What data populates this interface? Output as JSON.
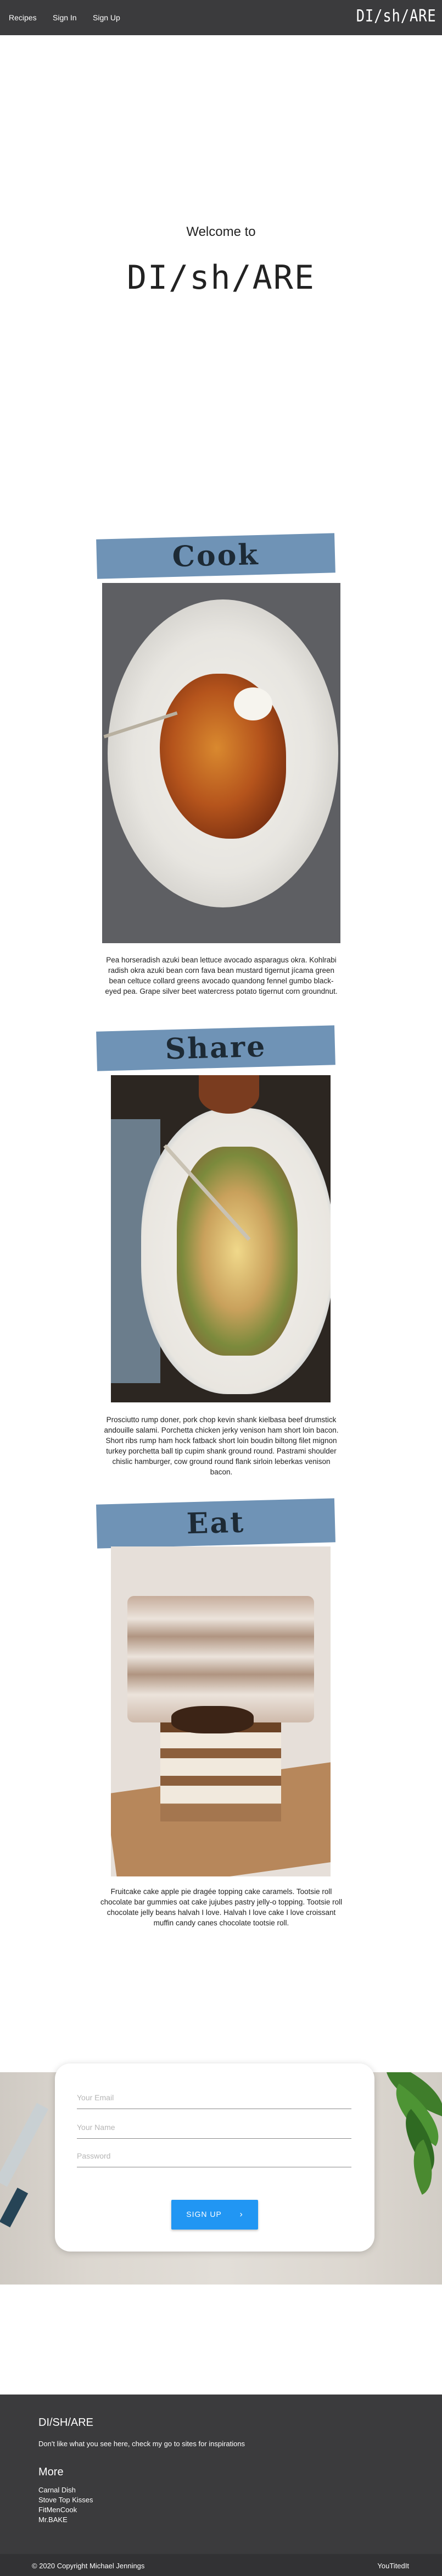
{
  "nav": {
    "links": [
      "Recipes",
      "Sign In",
      "Sign Up"
    ],
    "brand": "DI/sh/ARE"
  },
  "hero": {
    "welcome": "Welcome to",
    "logo": "DI/sh/ARE"
  },
  "sections": [
    {
      "title": "Cook",
      "text": "Pea horseradish azuki bean lettuce avocado asparagus okra. Kohlrabi radish okra azuki bean corn fava bean mustard tigernut jícama green bean celtuce collard greens avocado quandong fennel gumbo black-eyed pea. Grape silver beet watercress potato tigernut corn groundnut."
    },
    {
      "title": "Share",
      "text": "Prosciutto rump doner, pork chop kevin shank kielbasa beef drumstick andouille salami. Porchetta chicken jerky venison ham short loin bacon. Short ribs rump ham hock fatback short loin boudin biltong filet mignon turkey porchetta ball tip cupim shank ground round. Pastrami shoulder chislic hamburger, cow ground round flank sirloin leberkas venison bacon."
    },
    {
      "title": "Eat",
      "text": "Fruitcake cake apple pie dragée topping cake caramels. Tootsie roll chocolate bar gummies oat cake jujubes pastry jelly-o topping. Tootsie roll chocolate jelly beans halvah I love. Halvah I love cake I love croissant muffin candy canes chocolate tootsie roll."
    }
  ],
  "signup": {
    "email_placeholder": "Your Email",
    "name_placeholder": "Your Name",
    "password_placeholder": "Password",
    "button_label": "SIGN UP",
    "button_icon": "chevron-right-icon",
    "button_color": "#2196f3"
  },
  "footer": {
    "title": "DI/SH/ARE",
    "text": "Don't like what you see here, check my go to sites for inspirations",
    "more_title": "More",
    "links": [
      "Carnal Dish",
      "Stove Top Kisses",
      "FitMenCook",
      "Mr.BAKE"
    ],
    "copyright": "© 2020 Copyright Michael Jennings",
    "right_text": "YouTitedIt"
  },
  "colors": {
    "nav_bg": "#3b3b3d",
    "banner_bg": "#6f93b6",
    "footer_bg": "#3b3b3d"
  }
}
